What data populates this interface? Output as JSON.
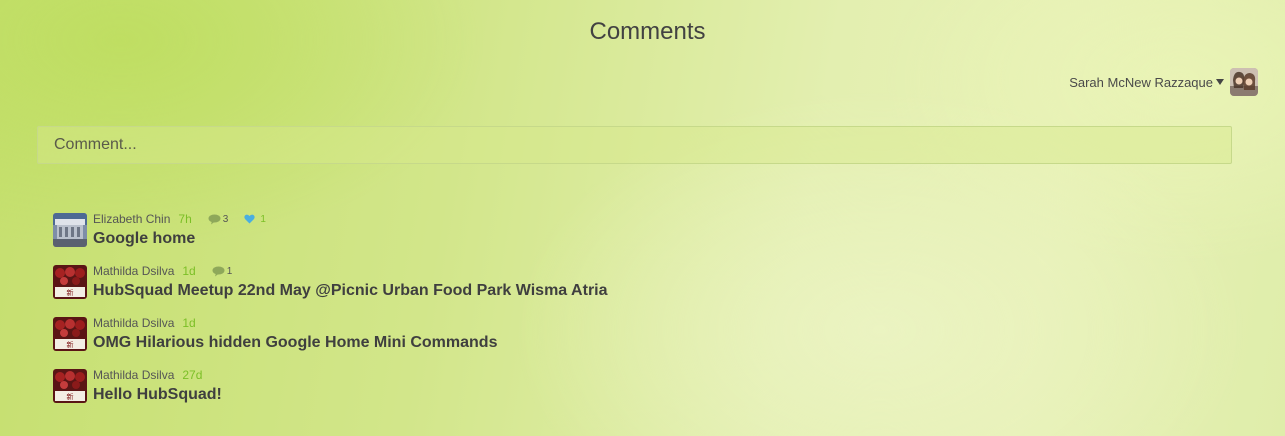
{
  "page": {
    "title": "Comments"
  },
  "user": {
    "name": "Sarah McNew Razzaque",
    "avatar_icon": "user-avatar-photo"
  },
  "comment_box": {
    "placeholder": "Comment..."
  },
  "colors": {
    "time": "#7bbf26",
    "heart": "#4aaee0",
    "bubble": "#8ea85a"
  },
  "threads": [
    {
      "author": "Elizabeth Chin",
      "time": "7h",
      "comments": "3",
      "likes": "1",
      "title": "Google home",
      "avatar_icon": "building-photo-avatar"
    },
    {
      "author": "Mathilda Dsilva",
      "time": "1d",
      "comments": "1",
      "likes": "",
      "title": "HubSquad Meetup 22nd May @Picnic Urban Food Park Wisma Atria",
      "avatar_icon": "chinese-sign-avatar"
    },
    {
      "author": "Mathilda Dsilva",
      "time": "1d",
      "comments": "",
      "likes": "",
      "title": "OMG Hilarious hidden Google Home Mini Commands",
      "avatar_icon": "chinese-sign-avatar"
    },
    {
      "author": "Mathilda Dsilva",
      "time": "27d",
      "comments": "",
      "likes": "",
      "title": "Hello HubSquad!",
      "avatar_icon": "chinese-sign-avatar"
    }
  ]
}
